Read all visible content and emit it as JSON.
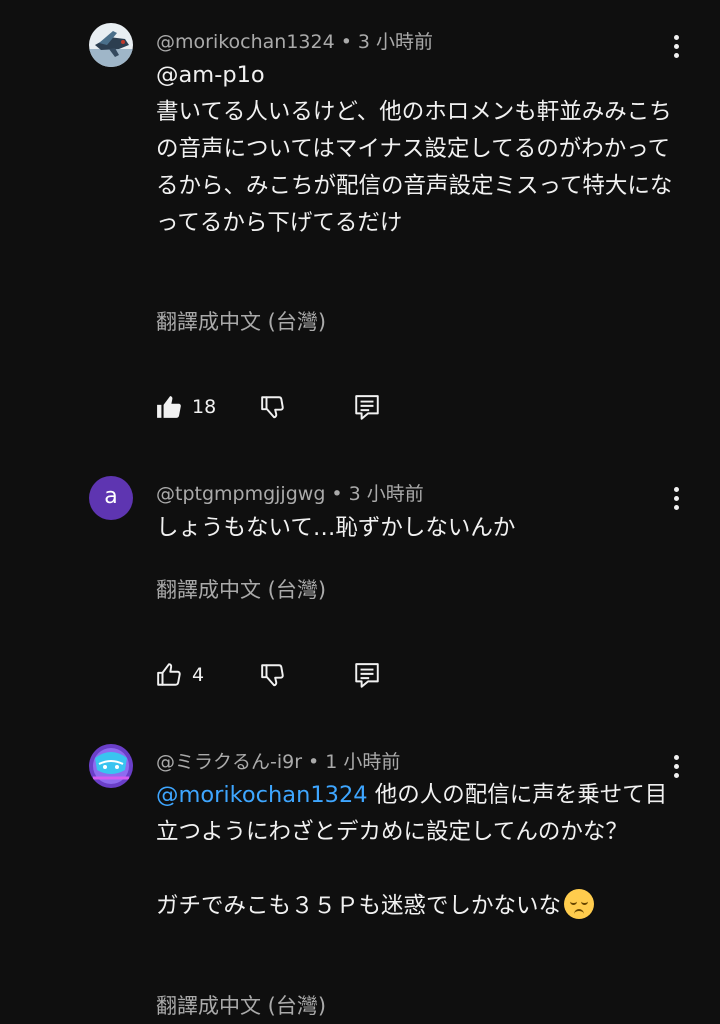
{
  "comments": [
    {
      "author": "@morikochan1324",
      "time": "3 小時前",
      "reply_to": "@am-p1o",
      "text": "書いてる人いるけど、他のホロメンも軒並みみこちの音声についてはマイナス設定してるのがわかってるから、みこちが配信の音声設定ミスって特大になってるから下げてるだけ",
      "translate": "翻譯成中文 (台灣)",
      "likes": "18"
    },
    {
      "author": "@tptgmpmgjjgwg",
      "avatar_letter": "a",
      "time": "3 小時前",
      "text": "しょうもないて…恥ずかしないんか",
      "translate": "翻譯成中文 (台灣)",
      "likes": "4"
    },
    {
      "author": "@ミラクるん-i9r",
      "time": "1 小時前",
      "mention": "@morikochan1324",
      "text_a": " 他の人の配信に声を乗せて目立つようにわざとデカめに設定してんのかな？",
      "text_b": "ガチでみこも３５Ｐも迷惑でしかないな",
      "emoji": "pensive-face",
      "translate": "翻譯成中文 (台灣)"
    }
  ]
}
